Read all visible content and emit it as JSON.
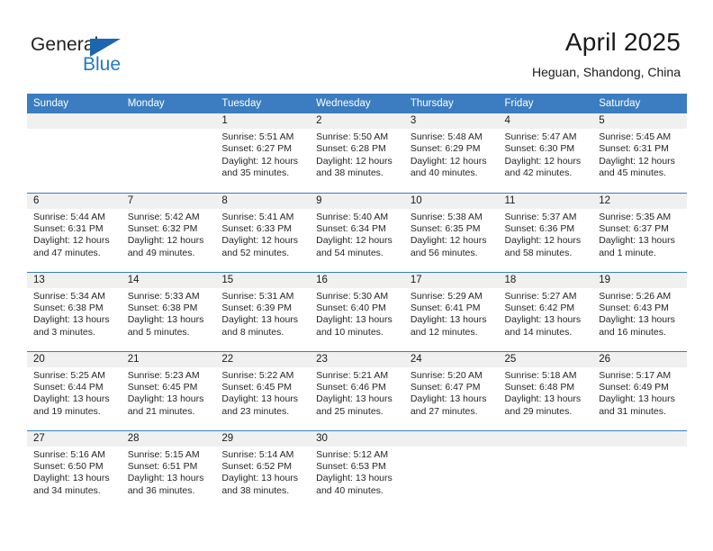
{
  "brand": {
    "name_part1": "General",
    "name_part2": "Blue",
    "triangle_icon": "triangle-icon",
    "accent_color": "#1f7ac4",
    "header_color": "#3b7dc0"
  },
  "header": {
    "title": "April 2025",
    "subtitle": "Heguan, Shandong, China"
  },
  "weekdays": [
    "Sunday",
    "Monday",
    "Tuesday",
    "Wednesday",
    "Thursday",
    "Friday",
    "Saturday"
  ],
  "weeks": [
    [
      {
        "day": "",
        "sunrise": "",
        "sunset": "",
        "daylight1": "",
        "daylight2": ""
      },
      {
        "day": "",
        "sunrise": "",
        "sunset": "",
        "daylight1": "",
        "daylight2": ""
      },
      {
        "day": "1",
        "sunrise": "Sunrise: 5:51 AM",
        "sunset": "Sunset: 6:27 PM",
        "daylight1": "Daylight: 12 hours",
        "daylight2": "and 35 minutes."
      },
      {
        "day": "2",
        "sunrise": "Sunrise: 5:50 AM",
        "sunset": "Sunset: 6:28 PM",
        "daylight1": "Daylight: 12 hours",
        "daylight2": "and 38 minutes."
      },
      {
        "day": "3",
        "sunrise": "Sunrise: 5:48 AM",
        "sunset": "Sunset: 6:29 PM",
        "daylight1": "Daylight: 12 hours",
        "daylight2": "and 40 minutes."
      },
      {
        "day": "4",
        "sunrise": "Sunrise: 5:47 AM",
        "sunset": "Sunset: 6:30 PM",
        "daylight1": "Daylight: 12 hours",
        "daylight2": "and 42 minutes."
      },
      {
        "day": "5",
        "sunrise": "Sunrise: 5:45 AM",
        "sunset": "Sunset: 6:31 PM",
        "daylight1": "Daylight: 12 hours",
        "daylight2": "and 45 minutes."
      }
    ],
    [
      {
        "day": "6",
        "sunrise": "Sunrise: 5:44 AM",
        "sunset": "Sunset: 6:31 PM",
        "daylight1": "Daylight: 12 hours",
        "daylight2": "and 47 minutes."
      },
      {
        "day": "7",
        "sunrise": "Sunrise: 5:42 AM",
        "sunset": "Sunset: 6:32 PM",
        "daylight1": "Daylight: 12 hours",
        "daylight2": "and 49 minutes."
      },
      {
        "day": "8",
        "sunrise": "Sunrise: 5:41 AM",
        "sunset": "Sunset: 6:33 PM",
        "daylight1": "Daylight: 12 hours",
        "daylight2": "and 52 minutes."
      },
      {
        "day": "9",
        "sunrise": "Sunrise: 5:40 AM",
        "sunset": "Sunset: 6:34 PM",
        "daylight1": "Daylight: 12 hours",
        "daylight2": "and 54 minutes."
      },
      {
        "day": "10",
        "sunrise": "Sunrise: 5:38 AM",
        "sunset": "Sunset: 6:35 PM",
        "daylight1": "Daylight: 12 hours",
        "daylight2": "and 56 minutes."
      },
      {
        "day": "11",
        "sunrise": "Sunrise: 5:37 AM",
        "sunset": "Sunset: 6:36 PM",
        "daylight1": "Daylight: 12 hours",
        "daylight2": "and 58 minutes."
      },
      {
        "day": "12",
        "sunrise": "Sunrise: 5:35 AM",
        "sunset": "Sunset: 6:37 PM",
        "daylight1": "Daylight: 13 hours",
        "daylight2": "and 1 minute."
      }
    ],
    [
      {
        "day": "13",
        "sunrise": "Sunrise: 5:34 AM",
        "sunset": "Sunset: 6:38 PM",
        "daylight1": "Daylight: 13 hours",
        "daylight2": "and 3 minutes."
      },
      {
        "day": "14",
        "sunrise": "Sunrise: 5:33 AM",
        "sunset": "Sunset: 6:38 PM",
        "daylight1": "Daylight: 13 hours",
        "daylight2": "and 5 minutes."
      },
      {
        "day": "15",
        "sunrise": "Sunrise: 5:31 AM",
        "sunset": "Sunset: 6:39 PM",
        "daylight1": "Daylight: 13 hours",
        "daylight2": "and 8 minutes."
      },
      {
        "day": "16",
        "sunrise": "Sunrise: 5:30 AM",
        "sunset": "Sunset: 6:40 PM",
        "daylight1": "Daylight: 13 hours",
        "daylight2": "and 10 minutes."
      },
      {
        "day": "17",
        "sunrise": "Sunrise: 5:29 AM",
        "sunset": "Sunset: 6:41 PM",
        "daylight1": "Daylight: 13 hours",
        "daylight2": "and 12 minutes."
      },
      {
        "day": "18",
        "sunrise": "Sunrise: 5:27 AM",
        "sunset": "Sunset: 6:42 PM",
        "daylight1": "Daylight: 13 hours",
        "daylight2": "and 14 minutes."
      },
      {
        "day": "19",
        "sunrise": "Sunrise: 5:26 AM",
        "sunset": "Sunset: 6:43 PM",
        "daylight1": "Daylight: 13 hours",
        "daylight2": "and 16 minutes."
      }
    ],
    [
      {
        "day": "20",
        "sunrise": "Sunrise: 5:25 AM",
        "sunset": "Sunset: 6:44 PM",
        "daylight1": "Daylight: 13 hours",
        "daylight2": "and 19 minutes."
      },
      {
        "day": "21",
        "sunrise": "Sunrise: 5:23 AM",
        "sunset": "Sunset: 6:45 PM",
        "daylight1": "Daylight: 13 hours",
        "daylight2": "and 21 minutes."
      },
      {
        "day": "22",
        "sunrise": "Sunrise: 5:22 AM",
        "sunset": "Sunset: 6:45 PM",
        "daylight1": "Daylight: 13 hours",
        "daylight2": "and 23 minutes."
      },
      {
        "day": "23",
        "sunrise": "Sunrise: 5:21 AM",
        "sunset": "Sunset: 6:46 PM",
        "daylight1": "Daylight: 13 hours",
        "daylight2": "and 25 minutes."
      },
      {
        "day": "24",
        "sunrise": "Sunrise: 5:20 AM",
        "sunset": "Sunset: 6:47 PM",
        "daylight1": "Daylight: 13 hours",
        "daylight2": "and 27 minutes."
      },
      {
        "day": "25",
        "sunrise": "Sunrise: 5:18 AM",
        "sunset": "Sunset: 6:48 PM",
        "daylight1": "Daylight: 13 hours",
        "daylight2": "and 29 minutes."
      },
      {
        "day": "26",
        "sunrise": "Sunrise: 5:17 AM",
        "sunset": "Sunset: 6:49 PM",
        "daylight1": "Daylight: 13 hours",
        "daylight2": "and 31 minutes."
      }
    ],
    [
      {
        "day": "27",
        "sunrise": "Sunrise: 5:16 AM",
        "sunset": "Sunset: 6:50 PM",
        "daylight1": "Daylight: 13 hours",
        "daylight2": "and 34 minutes."
      },
      {
        "day": "28",
        "sunrise": "Sunrise: 5:15 AM",
        "sunset": "Sunset: 6:51 PM",
        "daylight1": "Daylight: 13 hours",
        "daylight2": "and 36 minutes."
      },
      {
        "day": "29",
        "sunrise": "Sunrise: 5:14 AM",
        "sunset": "Sunset: 6:52 PM",
        "daylight1": "Daylight: 13 hours",
        "daylight2": "and 38 minutes."
      },
      {
        "day": "30",
        "sunrise": "Sunrise: 5:12 AM",
        "sunset": "Sunset: 6:53 PM",
        "daylight1": "Daylight: 13 hours",
        "daylight2": "and 40 minutes."
      },
      {
        "day": "",
        "sunrise": "",
        "sunset": "",
        "daylight1": "",
        "daylight2": ""
      },
      {
        "day": "",
        "sunrise": "",
        "sunset": "",
        "daylight1": "",
        "daylight2": ""
      },
      {
        "day": "",
        "sunrise": "",
        "sunset": "",
        "daylight1": "",
        "daylight2": ""
      }
    ]
  ]
}
